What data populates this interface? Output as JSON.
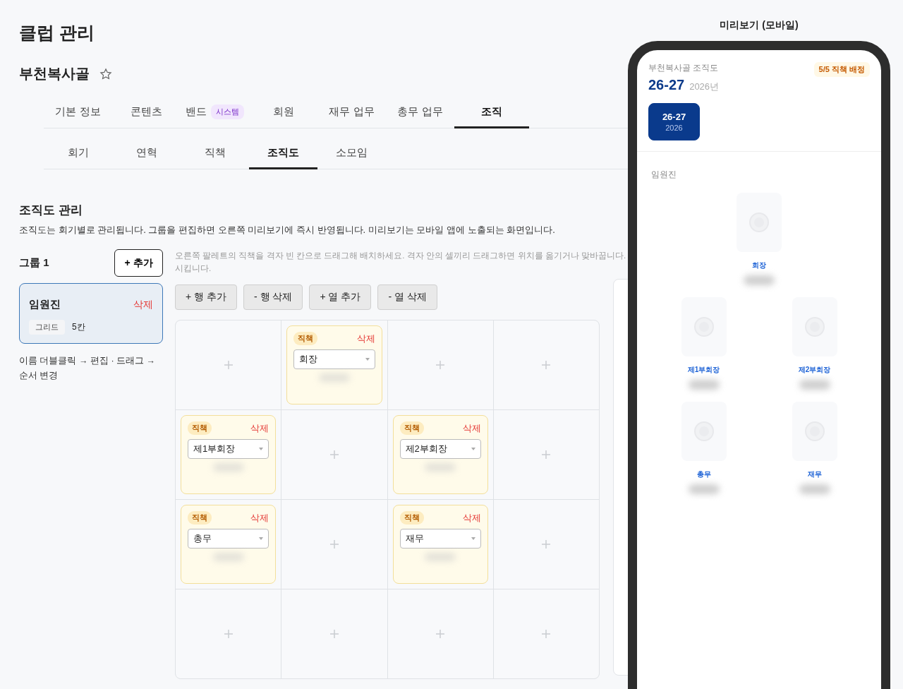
{
  "page_title": "클럽 관리",
  "club": {
    "name": "부천복사골",
    "favorite": false
  },
  "main_tabs": [
    {
      "label": "기본 정보",
      "selected": false
    },
    {
      "label": "콘텐츠",
      "selected": false
    },
    {
      "label": "밴드",
      "badge": "시스템",
      "selected": false
    },
    {
      "label": "회원",
      "selected": false
    },
    {
      "label": "재무 업무",
      "selected": false
    },
    {
      "label": "총무 업무",
      "selected": false
    },
    {
      "label": "조직",
      "selected": true
    }
  ],
  "sub_tabs": [
    {
      "label": "회기",
      "selected": false
    },
    {
      "label": "연혁",
      "selected": false
    },
    {
      "label": "직책",
      "selected": false
    },
    {
      "label": "조직도",
      "selected": true
    },
    {
      "label": "소모임",
      "selected": false
    }
  ],
  "section": {
    "title": "조직도 관리",
    "description": "조직도는 회기별로 관리됩니다. 그룹을 편집하면 오른쪽 미리보기에 즉시 반영됩니다. 미리보기는 모바일 앱에 노출되는 화면입니다."
  },
  "groups_panel": {
    "title": "그룹 1",
    "add_button": "+ 추가",
    "groups": [
      {
        "name": "임원진",
        "delete": "삭제",
        "tag": "그리드",
        "size": "5칸",
        "selected": true
      }
    ],
    "hint": "이름 더블클릭 → 편집 · 드래그 → 순서 변경"
  },
  "editor": {
    "hint_lines": [
      "오른쪽 팔레트의 직책을 격자 빈 칸으로 드래그해 배치하세요. 격자 안의 셀끼리 드래그하면 위치를 옮기거나 맞바꿉니다.",
      "시킵니다."
    ],
    "buttons": [
      "+ 행 추가",
      "- 행 삭제",
      "+ 열 추가",
      "- 열 삭제"
    ],
    "grid": [
      [
        {
          "kind": "empty"
        },
        {
          "kind": "position",
          "tag": "직책",
          "delete": "삭제",
          "value": "회장"
        },
        {
          "kind": "empty"
        },
        {
          "kind": "empty"
        }
      ],
      [
        {
          "kind": "position",
          "tag": "직책",
          "delete": "삭제",
          "value": "제1부회장"
        },
        {
          "kind": "empty"
        },
        {
          "kind": "position",
          "tag": "직책",
          "delete": "삭제",
          "value": "제2부회장"
        },
        {
          "kind": "empty"
        }
      ],
      [
        {
          "kind": "position",
          "tag": "직책",
          "delete": "삭제",
          "value": "총무"
        },
        {
          "kind": "empty"
        },
        {
          "kind": "position",
          "tag": "직책",
          "delete": "삭제",
          "value": "재무"
        },
        {
          "kind": "empty"
        }
      ],
      [
        {
          "kind": "empty"
        },
        {
          "kind": "empty"
        },
        {
          "kind": "empty"
        },
        {
          "kind": "empty"
        }
      ]
    ]
  },
  "preview": {
    "title": "미리보기 (모바일)",
    "header": "부천복사골 조직도",
    "season": "26-27",
    "year": "2026년",
    "badge": "5/5 직책 배정",
    "seasons": [
      {
        "label": "26-27",
        "year": "2026",
        "selected": true
      }
    ],
    "group_label": "임원진",
    "rows": [
      [
        {
          "title": "회장"
        }
      ],
      [
        {
          "title": "제1부회장"
        },
        {
          "title": "제2부회장"
        }
      ],
      [
        {
          "title": "총무"
        },
        {
          "title": "재무"
        }
      ]
    ]
  }
}
